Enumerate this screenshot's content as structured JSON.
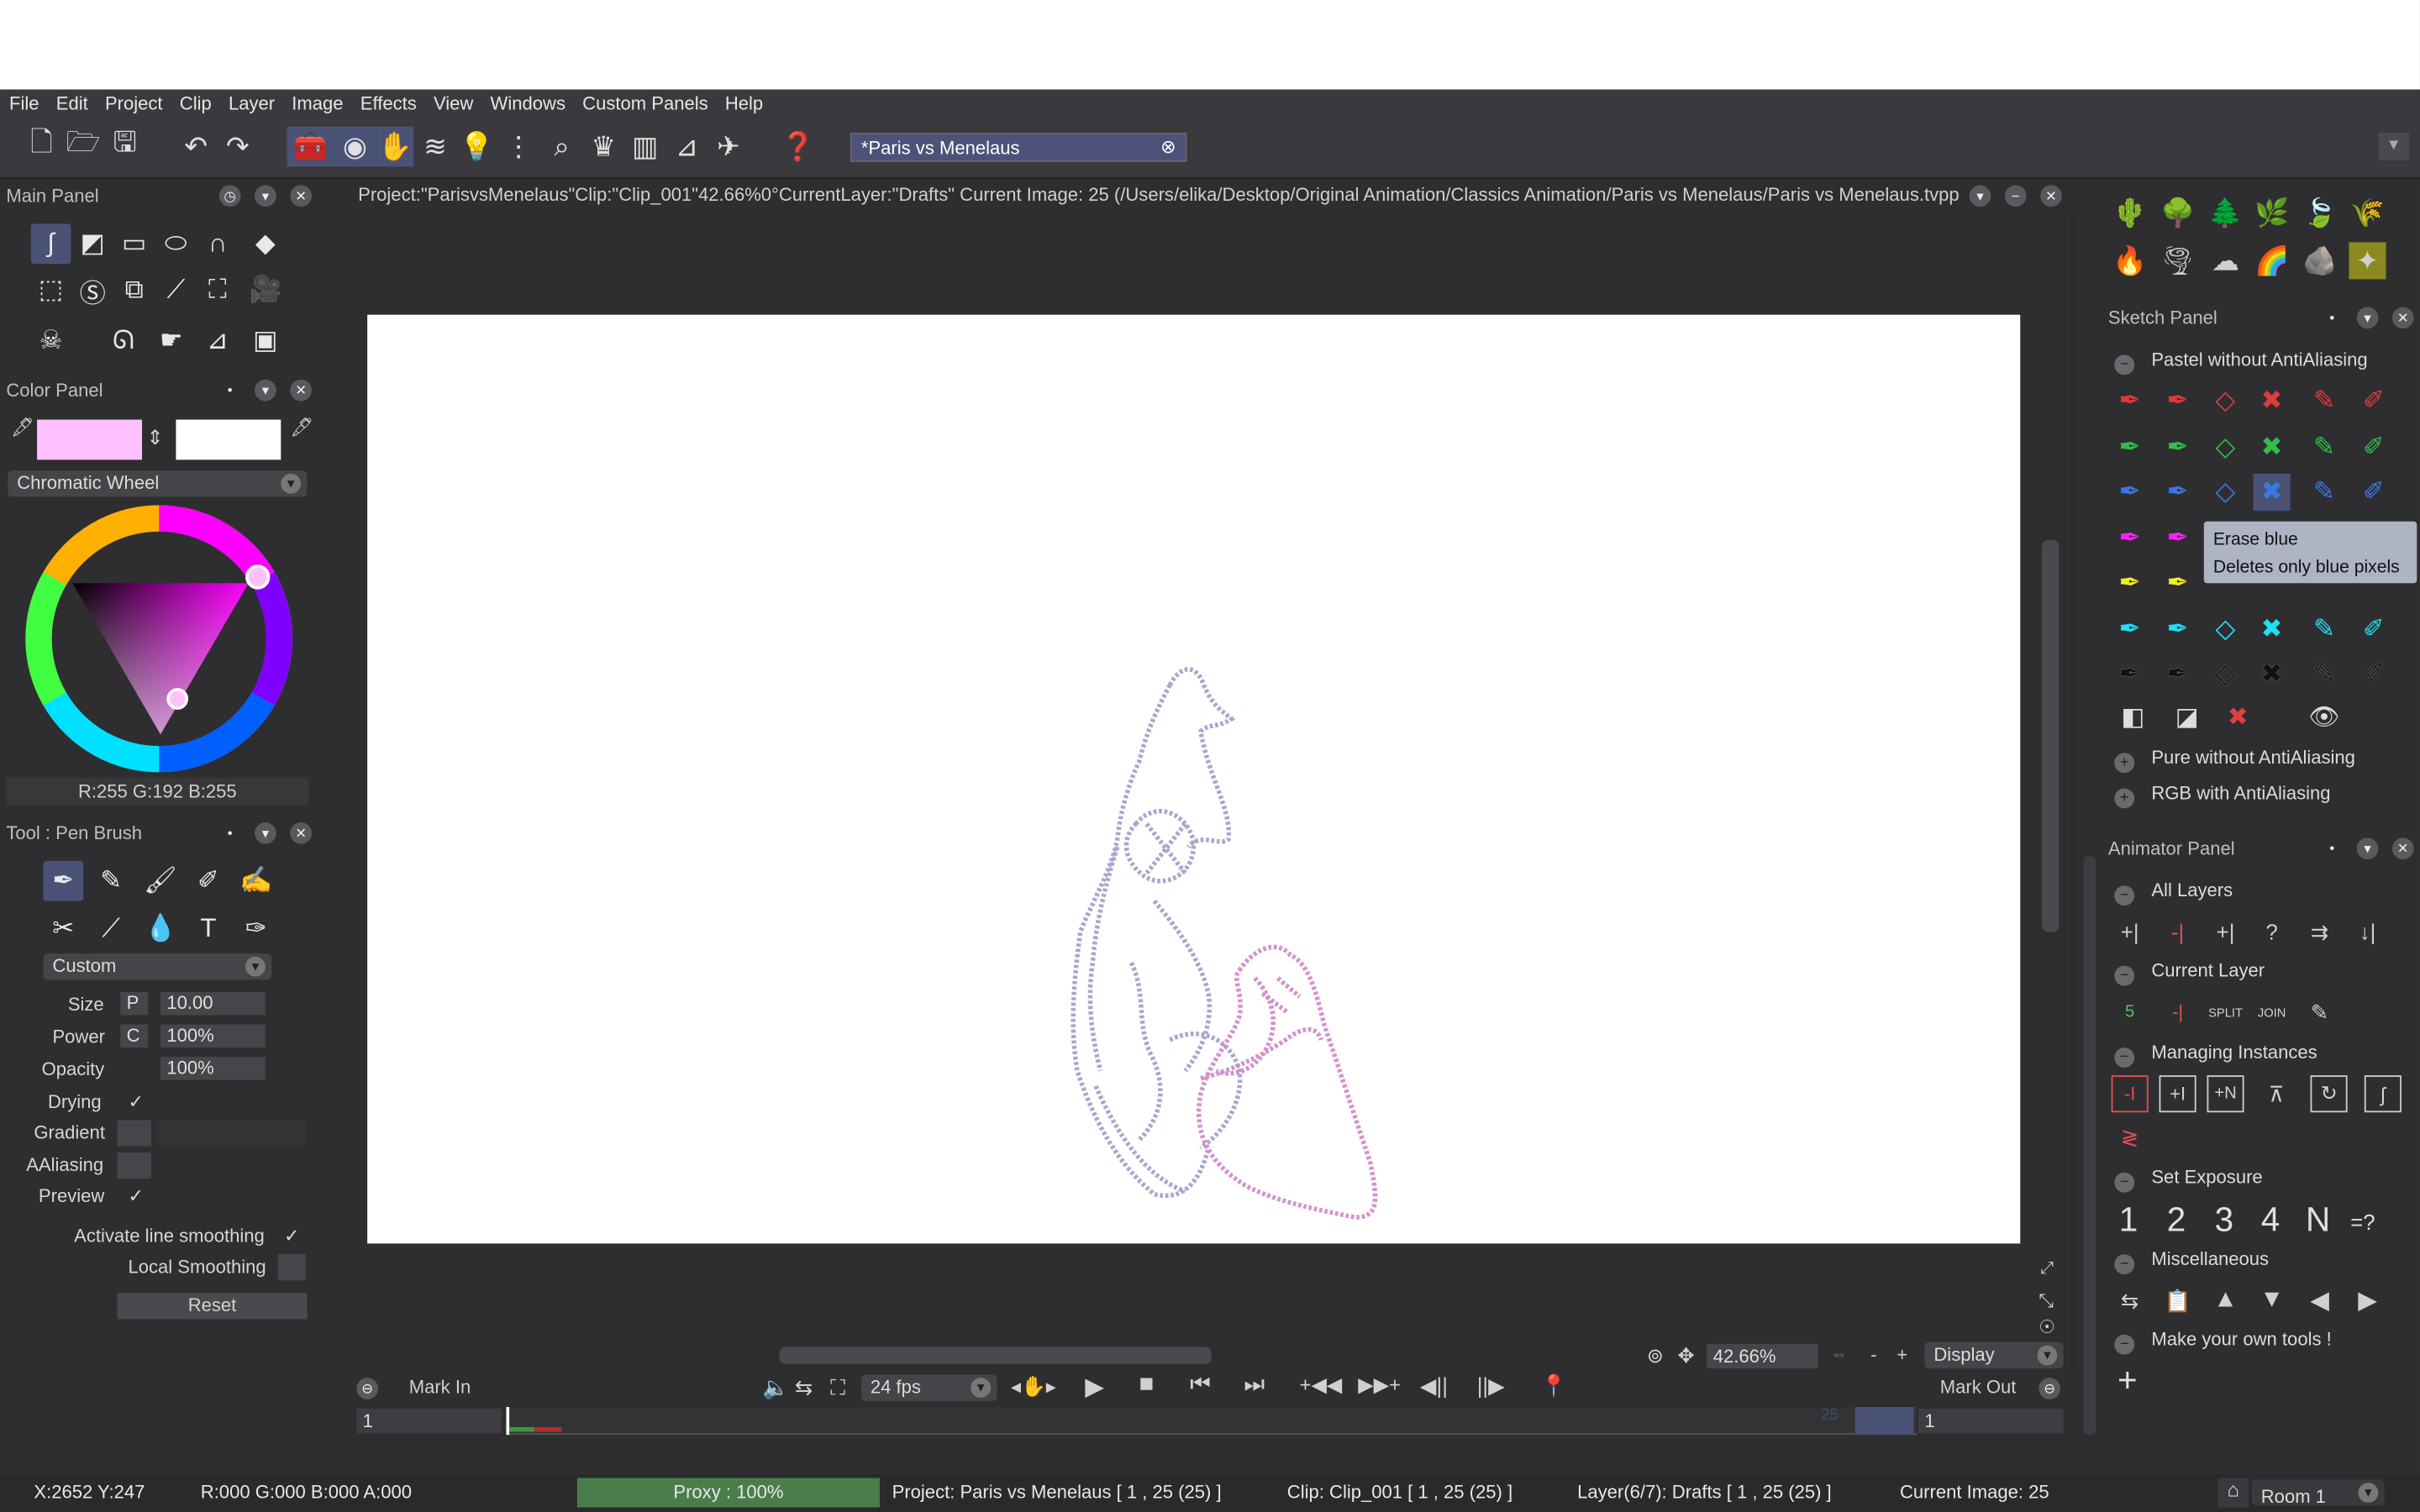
{
  "menu": [
    "File",
    "Edit",
    "Project",
    "Clip",
    "Layer",
    "Image",
    "Effects",
    "View",
    "Windows",
    "Custom Panels",
    "Help"
  ],
  "tab": {
    "title": "*Paris vs Menelaus",
    "close": "⊗"
  },
  "main_panel": {
    "title": "Main Panel"
  },
  "project_info": "Project:\"ParisvsMenelaus\"Clip:\"Clip_001\"42.66%0°CurrentLayer:\"Drafts\" Current Image: 25 (/Users/elika/Desktop/Original Animation/Classics Animation/Paris vs Menelaus/Paris vs Menelaus.tvpp",
  "color_panel": {
    "title": "Color Panel",
    "primary_color": "#ffc0ff",
    "secondary_color": "#ffffff",
    "mode": "Chromatic Wheel",
    "rgb_readout": "R:255 G:192 B:255"
  },
  "tool_panel": {
    "title": "Tool : Pen Brush",
    "preset": "Custom",
    "size_label": "Size",
    "size_mode": "P",
    "size_value": "10.00",
    "power_label": "Power",
    "power_mode": "C",
    "power_value": "100%",
    "opacity_label": "Opacity",
    "opacity_value": "100%",
    "drying_label": "Drying",
    "drying_check": "✓",
    "gradient_label": "Gradient",
    "aaliasing_label": "AAliasing",
    "preview_label": "Preview",
    "preview_check": "✓",
    "smoothing_label": "Activate line smoothing",
    "smoothing_check": "✓",
    "local_smoothing_label": "Local Smoothing",
    "reset_label": "Reset"
  },
  "sketch_panel": {
    "title": "Sketch Panel",
    "group1": "Pastel without AntiAliasing",
    "group2": "Pure without AntiAliasing",
    "group3": "RGB with AntiAliasing",
    "tooltip_title": "Erase blue",
    "tooltip_desc": "Deletes only blue pixels"
  },
  "animator_panel": {
    "title": "Animator Panel",
    "s1": "All Layers",
    "s2": "Current Layer",
    "s3": "Managing Instances",
    "s4": "Set Exposure",
    "s5": "Miscellaneous",
    "s6": "Make your own tools !",
    "exposure": [
      "1",
      "2",
      "3",
      "4",
      "N",
      "=?"
    ],
    "split_label": "SPLIT",
    "join_label": "JOIN"
  },
  "canvas_controls": {
    "zoom": "42.66%",
    "display": "Display",
    "minus": "-",
    "plus": "+"
  },
  "timeline": {
    "mark_in": "Mark In",
    "mark_out": "Mark Out",
    "fps": "24 fps",
    "in_value": "1",
    "out_value": "1",
    "current_frame": "25"
  },
  "status": {
    "coords": "X:2652  Y:247",
    "color": "R:000 G:000 B:000 A:000",
    "proxy": "Proxy : 100%",
    "proxy_progress": 1.0,
    "project": "Project: Paris vs Menelaus [ 1 , 25  (25) ]",
    "clip": "Clip: Clip_001 [ 1 , 25  (25) ]",
    "layer": "Layer(6/7): Drafts [ 1 , 25  (25) ]",
    "current_image": "Current Image: 25",
    "room": "Room 1"
  },
  "colors": {
    "accent": "#4a5275",
    "bg": "#2e2e31",
    "tab": "#4c5278",
    "proxy": "#3f6b3f"
  }
}
